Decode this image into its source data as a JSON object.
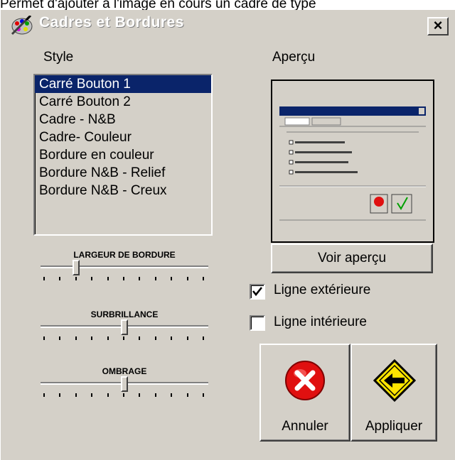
{
  "caption": "Permet d'ajouter à l'image en cours un cadre de type",
  "window": {
    "title": "Cadres et Bordures",
    "close_label": "×"
  },
  "style_section": {
    "label": "Style",
    "items": [
      "Carré Bouton 1",
      "Carré Bouton 2",
      "Cadre - N&B",
      "Cadre- Couleur",
      "Bordure en couleur",
      "Bordure N&B - Relief",
      "Bordure N&B - Creux"
    ],
    "selected_index": 0
  },
  "sliders": [
    {
      "label": "LARGEUR DE BORDURE",
      "value": 0.2
    },
    {
      "label": "SURBRILLANCE",
      "value": 0.5
    },
    {
      "label": "OMBRAGE",
      "value": 0.5
    }
  ],
  "preview": {
    "label": "Aperçu",
    "button_label": "Voir aperçu"
  },
  "options": {
    "outer_line_label": "Ligne extérieure",
    "outer_line_checked": true,
    "inner_line_label": "Ligne intérieure",
    "inner_line_checked": false
  },
  "actions": {
    "cancel_label": "Annuler",
    "apply_label": "Appliquer"
  },
  "colors": {
    "dialog_bg": "#d4d0c8",
    "selection": "#0a246a",
    "cancel_red": "#e01010",
    "apply_yellow": "#ffe400"
  }
}
